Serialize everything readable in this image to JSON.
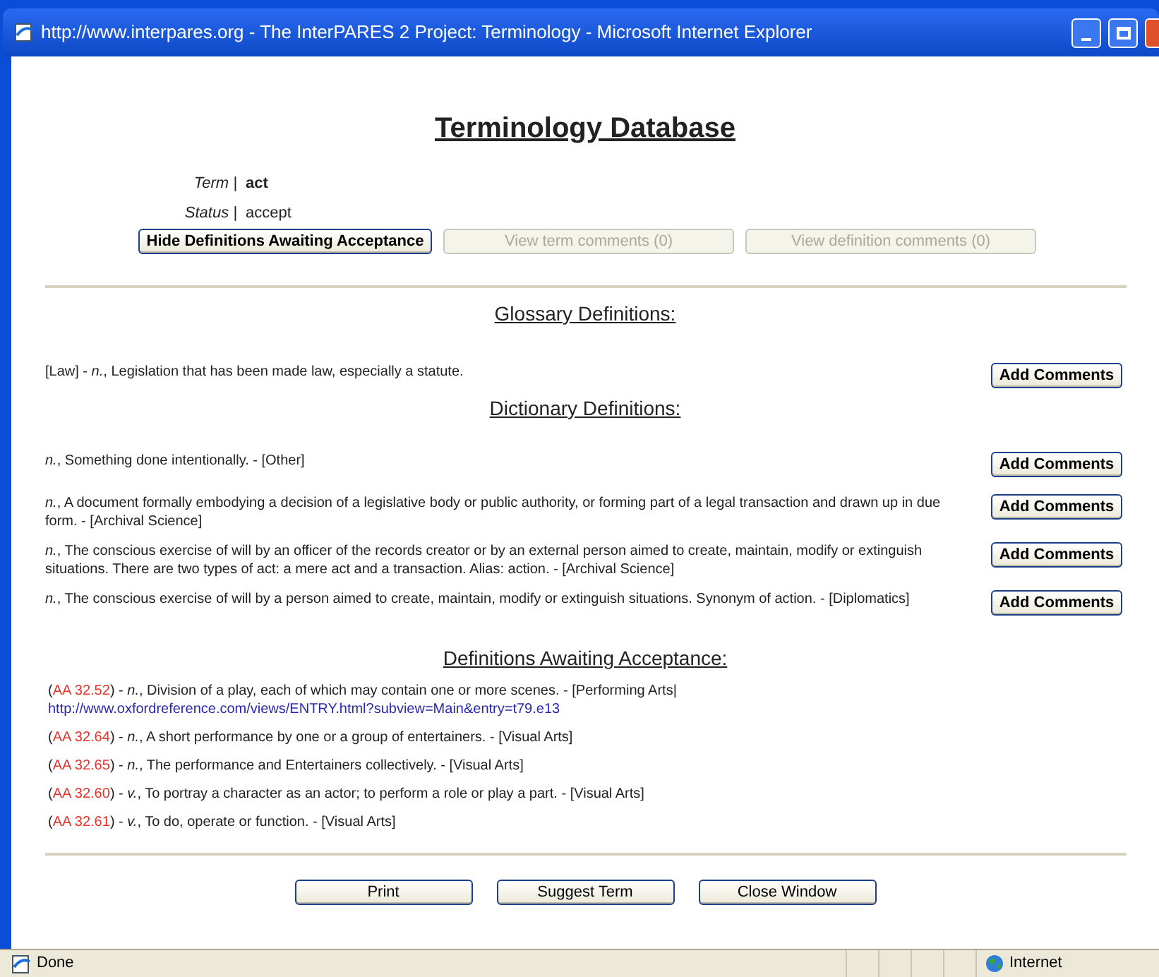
{
  "window": {
    "title": "http://www.interpares.org - The InterPARES 2 Project: Terminology - Microsoft Internet Explorer"
  },
  "page_title": "Terminology Database",
  "fields": [
    {
      "label": "Term |",
      "value": "act",
      "bold": true
    },
    {
      "label": "Status |",
      "value": "accept",
      "bold": false
    }
  ],
  "top_buttons": [
    {
      "label": "Hide Definitions Awaiting Acceptance",
      "disabled": false
    },
    {
      "label": "View term comments (0)",
      "disabled": true
    },
    {
      "label": "View definition comments (0)",
      "disabled": true
    }
  ],
  "sections": [
    {
      "heading": "Glossary Definitions:",
      "items": [
        {
          "text": "[Law] - *n.*, Legislation that has been made law, especially a statute.",
          "button": "Add Comments"
        }
      ]
    },
    {
      "heading": "Dictionary Definitions:",
      "items": [
        {
          "text": "*n.*, Something done intentionally. - [Other]",
          "button": "Add Comments"
        },
        {
          "text": "*n.*, A document formally embodying a decision of a legislative body or public authority, or forming part of a legal transaction and drawn up in due form. - [Archival Science]",
          "button": "Add Comments"
        },
        {
          "text": "*n.*, The conscious exercise of will by an officer of the records creator or by an external person aimed to create, maintain, modify or extinguish situations. There are two types of act: a mere act and a transaction. Alias: action. - [Archival Science]",
          "button": "Add Comments"
        },
        {
          "text": "*n.*, The conscious exercise of will by a person aimed to create, maintain, modify or extinguish situations. Synonym of action. - [Diplomatics]",
          "button": "Add Comments"
        }
      ]
    }
  ],
  "awaiting": {
    "heading": "Definitions Awaiting Acceptance:",
    "items": [
      {
        "open": "(",
        "id": "AA 32.52",
        "text": ") - *n.*, Division of a play, each of which may contain one or more scenes. - [Performing Arts|",
        "link": "http://www.oxfordreference.com/views/ENTRY.html?subview=Main&entry=t79.e13"
      },
      {
        "open": "(",
        "id": "AA 32.64",
        "text": ") - *n.*, A short performance by one or a group of entertainers. - [Visual Arts]"
      },
      {
        "open": "(",
        "id": "AA 32.65",
        "text": ") - *n.*, The performance and Entertainers collectively. - [Visual Arts]"
      },
      {
        "open": "(",
        "id": "AA 32.60",
        "text": ") - *v.*, To portray a character as an actor; to perform a role or play a part. - [Visual Arts]"
      },
      {
        "open": "(",
        "id": "AA 32.61",
        "text": ") - *v.*, To do, operate or function. - [Visual Arts]"
      }
    ]
  },
  "bottom_buttons": [
    "Print",
    "Suggest Term",
    "Close Window"
  ],
  "status_bar": {
    "text": "Done",
    "zone": "Internet"
  }
}
